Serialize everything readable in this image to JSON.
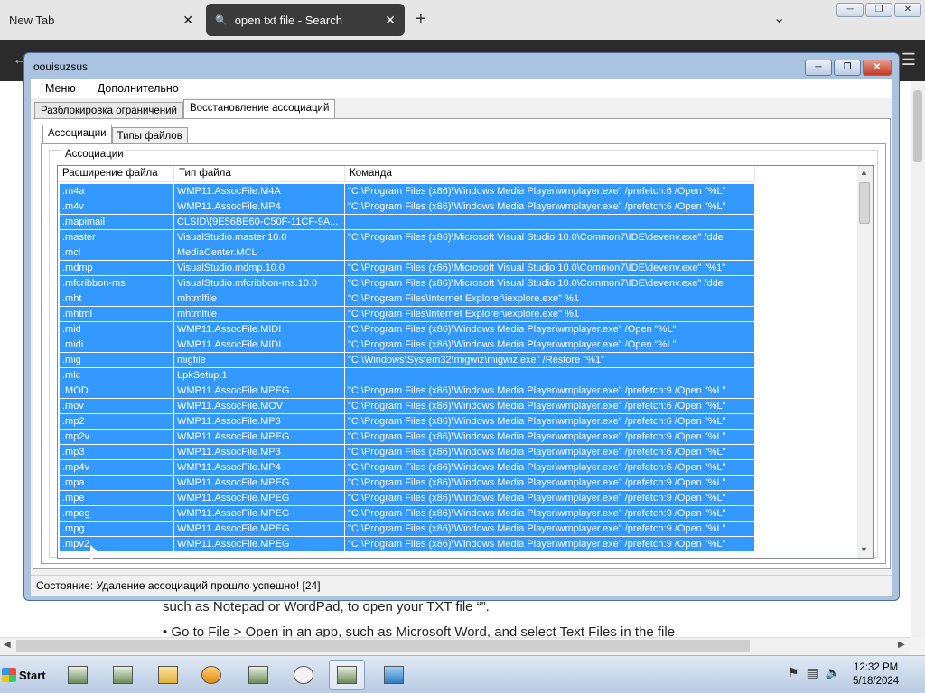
{
  "browser": {
    "tabs": [
      {
        "label": "New Tab",
        "close": "✕"
      },
      {
        "label": "open txt file - Search",
        "close": "✕"
      }
    ],
    "new_tab": "+",
    "page_text": [
      "such as Notepad or WordPad, to open your TXT file “”.",
      "•  Go to File > Open in an app, such as Microsoft Word, and select Text Files in the file"
    ]
  },
  "app": {
    "title": "oouisuzsus",
    "menu": [
      "Меню",
      "Дополнительно"
    ],
    "outer_tabs": [
      "Разблокировка ограничений",
      "Восстановление ассоциаций"
    ],
    "inner_tabs": [
      "Ассоциации",
      "Типы файлов"
    ],
    "group_label": "Ассоциации",
    "columns": [
      "Расширение файла",
      "Тип файла",
      "Команда"
    ],
    "rows": [
      [
        ".m4a",
        "WMP11.AssocFile.M4A",
        "\"C:\\Program Files (x86)\\Windows Media Player\\wmplayer.exe\" /prefetch:6 /Open \"%L\""
      ],
      [
        ".m4v",
        "WMP11.AssocFile.MP4",
        "\"C:\\Program Files (x86)\\Windows Media Player\\wmplayer.exe\" /prefetch:6 /Open \"%L\""
      ],
      [
        ".mapimail",
        "CLSID\\{9E56BE60-C50F-11CF-9A...",
        ""
      ],
      [
        ".master",
        "VisualStudio.master.10.0",
        "\"C:\\Program Files (x86)\\Microsoft Visual Studio 10.0\\Common7\\IDE\\devenv.exe\" /dde"
      ],
      [
        ".mcl",
        "MediaCenter.MCL",
        ""
      ],
      [
        ".mdmp",
        "VisualStudio.mdmp.10.0",
        "\"C:\\Program Files (x86)\\Microsoft Visual Studio 10.0\\Common7\\IDE\\devenv.exe\" \"%1\""
      ],
      [
        ".mfcribbon-ms",
        "VisualStudio.mfcribbon-ms.10.0",
        "\"C:\\Program Files (x86)\\Microsoft Visual Studio 10.0\\Common7\\IDE\\devenv.exe\" /dde"
      ],
      [
        ".mht",
        "mhtmlfile",
        "\"C:\\Program Files\\Internet Explorer\\iexplore.exe\" %1"
      ],
      [
        ".mhtml",
        "mhtmlfile",
        "\"C:\\Program Files\\Internet Explorer\\iexplore.exe\" %1"
      ],
      [
        ".mid",
        "WMP11.AssocFile.MIDI",
        "\"C:\\Program Files (x86)\\Windows Media Player\\wmplayer.exe\" /Open \"%L\""
      ],
      [
        ".midi",
        "WMP11.AssocFile.MIDI",
        "\"C:\\Program Files (x86)\\Windows Media Player\\wmplayer.exe\" /Open \"%L\""
      ],
      [
        ".mig",
        "migfile",
        "\"C:\\Windows\\System32\\migwiz\\migwiz.exe\" /Restore \"%1\""
      ],
      [
        ".mlc",
        "LpkSetup.1",
        ""
      ],
      [
        ".MOD",
        "WMP11.AssocFile.MPEG",
        "\"C:\\Program Files (x86)\\Windows Media Player\\wmplayer.exe\" /prefetch:9 /Open \"%L\""
      ],
      [
        ".mov",
        "WMP11.AssocFile.MOV",
        "\"C:\\Program Files (x86)\\Windows Media Player\\wmplayer.exe\" /prefetch:6 /Open \"%L\""
      ],
      [
        ".mp2",
        "WMP11.AssocFile.MP3",
        "\"C:\\Program Files (x86)\\Windows Media Player\\wmplayer.exe\" /prefetch:6 /Open \"%L\""
      ],
      [
        ".mp2v",
        "WMP11.AssocFile.MPEG",
        "\"C:\\Program Files (x86)\\Windows Media Player\\wmplayer.exe\" /prefetch:9 /Open \"%L\""
      ],
      [
        ".mp3",
        "WMP11.AssocFile.MP3",
        "\"C:\\Program Files (x86)\\Windows Media Player\\wmplayer.exe\" /prefetch:6 /Open \"%L\""
      ],
      [
        ".mp4v",
        "WMP11.AssocFile.MP4",
        "\"C:\\Program Files (x86)\\Windows Media Player\\wmplayer.exe\" /prefetch:6 /Open \"%L\""
      ],
      [
        ".mpa",
        "WMP11.AssocFile.MPEG",
        "\"C:\\Program Files (x86)\\Windows Media Player\\wmplayer.exe\" /prefetch:9 /Open \"%L\""
      ],
      [
        ".mpe",
        "WMP11.AssocFile.MPEG",
        "\"C:\\Program Files (x86)\\Windows Media Player\\wmplayer.exe\" /prefetch:9 /Open \"%L\""
      ],
      [
        ".mpeg",
        "WMP11.AssocFile.MPEG",
        "\"C:\\Program Files (x86)\\Windows Media Player\\wmplayer.exe\" /prefetch:9 /Open \"%L\""
      ],
      [
        ".mpg",
        "WMP11.AssocFile.MPEG",
        "\"C:\\Program Files (x86)\\Windows Media Player\\wmplayer.exe\" /prefetch:9 /Open \"%L\""
      ],
      [
        ".mpv2",
        "WMP11.AssocFile.MPEG",
        "\"C:\\Program Files (x86)\\Windows Media Player\\wmplayer.exe\" /prefetch:9 /Open \"%L\""
      ]
    ],
    "status": "Состояние: Удаление ассоциаций прошло успешно! [24]"
  },
  "taskbar": {
    "start_label": "Start",
    "time": "12:32 PM",
    "date": "5/18/2024"
  },
  "colors": {
    "selection": "#3399ff",
    "taskbar": "#c9d9ec"
  }
}
